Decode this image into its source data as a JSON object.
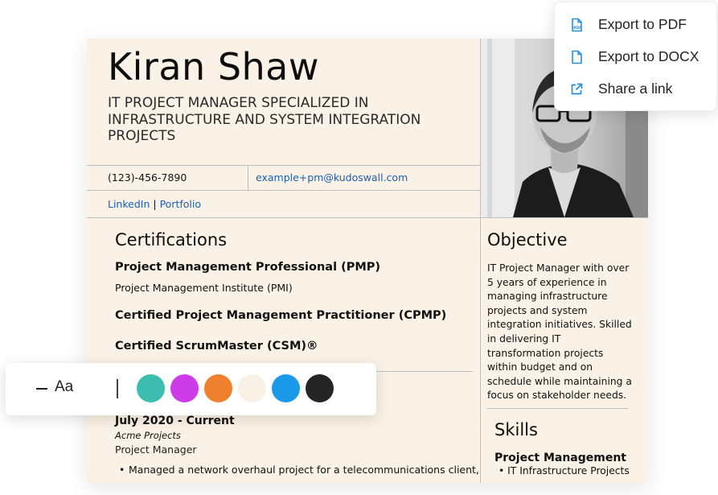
{
  "resume": {
    "name": "Kiran Shaw",
    "subtitle": "IT PROJECT MANAGER SPECIALIZED IN INFRASTRUCTURE AND SYSTEM INTEGRATION PROJECTS",
    "phone": "(123)-456-7890",
    "email": "example+pm@kudoswall.com",
    "links": {
      "linkedin": "LinkedIn",
      "separator": " | ",
      "portfolio": "Portfolio"
    },
    "certifications": {
      "heading": "Certifications",
      "items": [
        {
          "title": "Project Management Professional (PMP)",
          "org": "Project Management Institute (PMI)"
        },
        {
          "title": "Certified Project Management Practitioner (CPMP)"
        },
        {
          "title": "Certified ScrumMaster (CSM)®"
        }
      ]
    },
    "experience": {
      "date": "July 2020 - Current",
      "company": "Acme Projects",
      "role": "Project Manager",
      "bullet": "Managed a network overhaul project for a telecommunications client,"
    },
    "objective": {
      "heading": "Objective",
      "text": "IT Project Manager with over 5 years of experience in managing infrastructure projects and system integration initiatives. Skilled in delivering IT transformation projects within budget and on schedule while maintaining a focus on stakeholder needs."
    },
    "skills": {
      "heading": "Skills",
      "category": "Project Management",
      "item": "IT Infrastructure Projects"
    }
  },
  "export_menu": {
    "items": [
      {
        "label": "Export to PDF",
        "icon": "pdf-file-icon"
      },
      {
        "label": "Export to DOCX",
        "icon": "document-file-icon"
      },
      {
        "label": "Share a link",
        "icon": "external-link-icon"
      }
    ],
    "icon_color": "#1e90e8"
  },
  "style_toolbar": {
    "font_size_label": "Aa",
    "swatches": [
      "#3dbcb0",
      "#cd3ce8",
      "#f0802e",
      "#f9f1e6",
      "#1a9ae8",
      "#252525"
    ]
  }
}
